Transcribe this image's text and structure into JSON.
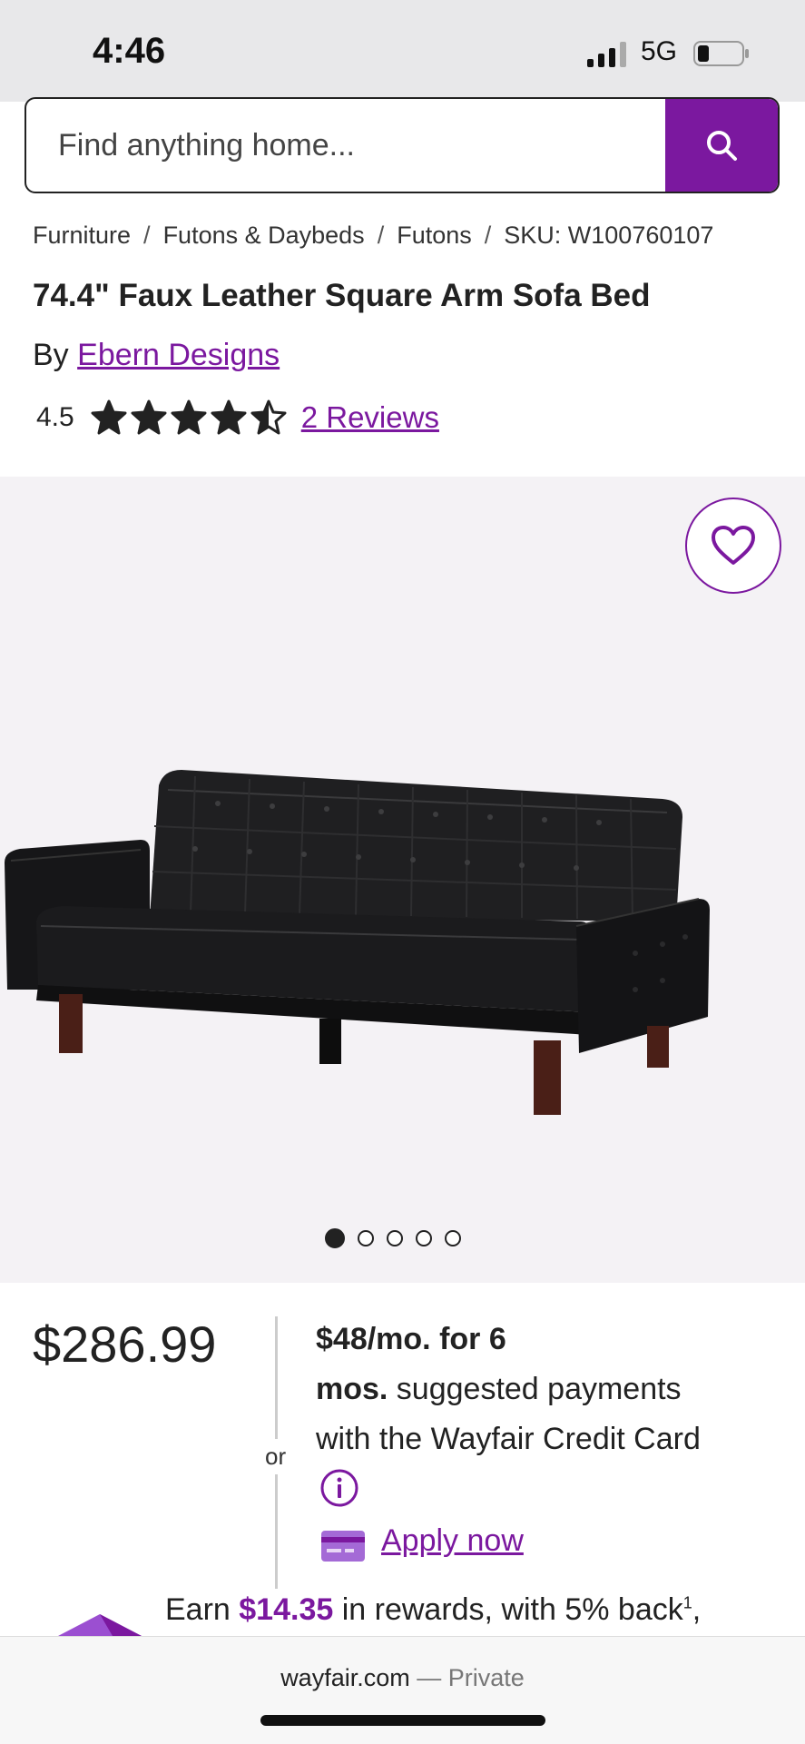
{
  "status": {
    "time": "4:46",
    "network": "5G"
  },
  "search": {
    "placeholder": "Find anything home..."
  },
  "breadcrumb": [
    "Furniture",
    "Futons & Daybeds",
    "Futons",
    "SKU: W100760107"
  ],
  "breadcrumb_separator": "/",
  "product": {
    "title": "74.4\" Faux Leather Square Arm Sofa Bed",
    "by_label": "By",
    "brand": "Ebern Designs",
    "rating": "4.5",
    "rating_value": 4.5,
    "rating_max": 5,
    "reviews_label": "2 Reviews"
  },
  "gallery": {
    "image_count": 5,
    "active_index": 0
  },
  "pricing": {
    "price": "$286.99",
    "or_label": "or",
    "finance_bold_1": "$48/mo. for 6",
    "finance_bold_2": "mos.",
    "finance_rest_1": " suggested payments",
    "finance_rest_2": "with the Wayfair Credit Card",
    "apply_label": "Apply now"
  },
  "rewards": {
    "prefix": "Earn ",
    "amount": "$14.35",
    "suffix": " in rewards, with 5% back",
    "superscript": "1",
    "trailing": ","
  },
  "browser": {
    "domain": "wayfair.com",
    "dash": " — ",
    "mode": "Private"
  },
  "colors": {
    "accent": "#7b189f",
    "gallery_bg": "#f4f2f5"
  }
}
